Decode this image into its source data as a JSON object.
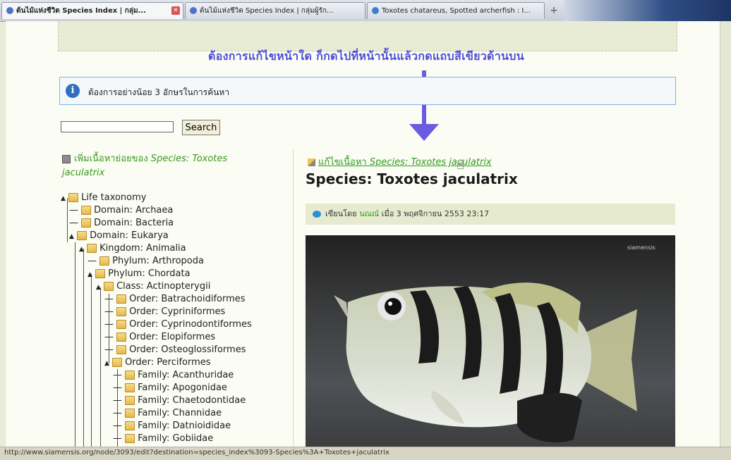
{
  "browser": {
    "tabs": [
      {
        "label": "ต้นไม้แห่งชีวิต Species Index | กลุ่ม...",
        "active": true
      },
      {
        "label": "ต้นไม้แห่งชีวิต Species Index | กลุ่มผู้รัก...",
        "active": false
      },
      {
        "label": "Toxotes chatareus, Spotted archerfish : I...",
        "active": false
      }
    ],
    "new_tab": "+"
  },
  "annotation": {
    "text": "ต้องการแก้ไขหน้าใด ก็กดไปที่หน้านั้นแล้วกดแถบสีเขียวด้านบน"
  },
  "info": {
    "icon": "i",
    "message": "ต้องการอย่างน้อย 3 อักษรในการค้นหา"
  },
  "search": {
    "value": "",
    "button_label": "Search"
  },
  "sidebar": {
    "subpages_prefix": "เพิ่มเนื้อหาย่อยของ ",
    "subpages_species": "Species: Toxotes jaculatrix",
    "tree": [
      {
        "label": "Life taxonomy",
        "depth": 0
      },
      {
        "label": "Domain: Archaea",
        "depth": 1
      },
      {
        "label": "Domain: Bacteria",
        "depth": 1
      },
      {
        "label": "Domain: Eukarya",
        "depth": 1
      },
      {
        "label": "Kingdom: Animalia",
        "depth": 2
      },
      {
        "label": "Phylum: Arthropoda",
        "depth": 3
      },
      {
        "label": "Phylum: Chordata",
        "depth": 3
      },
      {
        "label": "Class: Actinopterygii",
        "depth": 4
      },
      {
        "label": "Order: Batrachoidiformes",
        "depth": 5
      },
      {
        "label": "Order: Cypriniformes",
        "depth": 5
      },
      {
        "label": "Order: Cyprinodontiformes",
        "depth": 5
      },
      {
        "label": "Order: Elopiformes",
        "depth": 5
      },
      {
        "label": "Order: Osteoglossiformes",
        "depth": 5
      },
      {
        "label": "Order: Perciformes",
        "depth": 5
      },
      {
        "label": "Family: Acanthuridae",
        "depth": 6
      },
      {
        "label": "Family: Apogonidae",
        "depth": 6
      },
      {
        "label": "Family: Chaetodontidae",
        "depth": 6
      },
      {
        "label": "Family: Channidae",
        "depth": 6
      },
      {
        "label": "Family: Datnioididae",
        "depth": 6
      },
      {
        "label": "Family: Gobiidae",
        "depth": 6
      }
    ]
  },
  "content": {
    "edit_prefix": "แก้ไขเนื้อหา ",
    "edit_species": "Species: Toxotes jaculatrix",
    "title": "Species: Toxotes jaculatrix",
    "submitted_prefix": "เขียนโดย ",
    "author": "นณณ์",
    "submitted_suffix": " เมื่อ 3 พฤศจิกายน 2553 23:17",
    "photo_watermark": "siamensis"
  },
  "status_bar": {
    "url": "http://www.siamensis.org/node/3093/edit?destination=species_index%3093-Species%3A+Toxotes+jaculatrix"
  },
  "colors": {
    "link_green": "#2f9a1c",
    "annotation_blue": "#4d4fd6",
    "info_border": "#7fb5e3"
  }
}
